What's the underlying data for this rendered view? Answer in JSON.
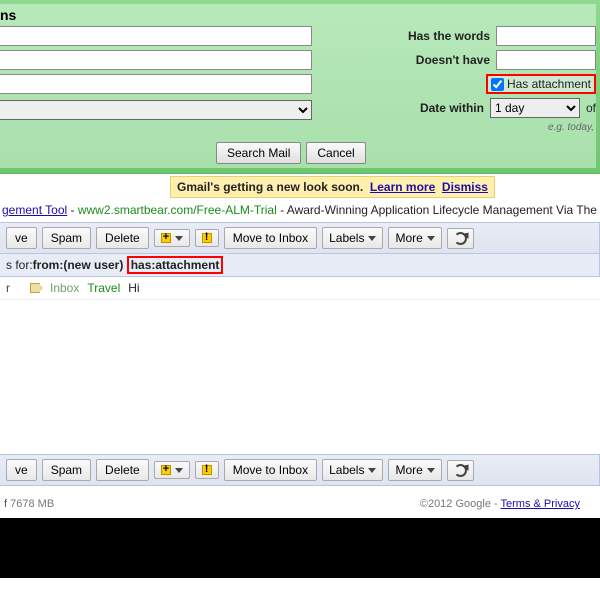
{
  "search_panel": {
    "title_fragment": "ns",
    "has_words_label": "Has the words",
    "doesnt_have_label": "Doesn't have",
    "has_attachment_label": "Has attachment",
    "has_attachment_checked": true,
    "date_within_label": "Date within",
    "date_within_value": "1 day",
    "of_label": "of",
    "hint": "e.g. today,",
    "search_btn": "Search Mail",
    "cancel_btn": "Cancel"
  },
  "notice": {
    "text": "Gmail's getting a new look soon.",
    "learn": "Learn more",
    "dismiss": "Dismiss"
  },
  "ad": {
    "link1": "gement Tool",
    "green": "www2.smartbear.com/Free-ALM-Trial",
    "tail": "Award-Winning Application Lifecycle Management Via The"
  },
  "toolbar": {
    "archive_fragment": "ve",
    "spam": "Spam",
    "delete": "Delete",
    "move": "Move to Inbox",
    "labels": "Labels",
    "more": "More"
  },
  "results": {
    "prefix": "s for:",
    "query1": "from:(new user)",
    "query2": "has:attachment"
  },
  "row": {
    "sender_fragment": "r",
    "label_inbox": "Inbox",
    "label_travel": "Travel",
    "subject": "Hi"
  },
  "footer": {
    "storage": "7678 MB",
    "copyright": "©2012 Google",
    "terms": "Terms & Privacy"
  }
}
